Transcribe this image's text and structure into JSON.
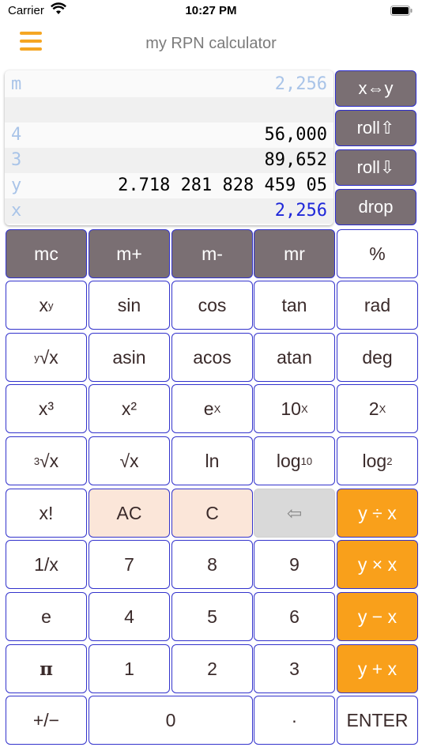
{
  "status": {
    "carrier": "Carrier",
    "time": "10:27 PM"
  },
  "nav": {
    "title": "my RPN calculator"
  },
  "registers": [
    {
      "label": "m",
      "value": "2,256",
      "color": "#a9c4e8"
    },
    {
      "label": "",
      "value": "",
      "color": "#000000"
    },
    {
      "label": "4",
      "value": "56,000",
      "color": "#000000"
    },
    {
      "label": "3",
      "value": "89,652",
      "color": "#000000"
    },
    {
      "label": "y",
      "value": "2.718 281 828 459 05",
      "color": "#000000"
    },
    {
      "label": "x",
      "value": "2,256",
      "color": "#1e27d9"
    }
  ],
  "stack_buttons": {
    "swap": "x⇔y",
    "roll_up": "roll⇧",
    "roll_down": "roll⇩",
    "drop": "drop"
  },
  "keys": {
    "mc": "mc",
    "mplus": "m+",
    "mminus": "m-",
    "mr": "mr",
    "percent": "%",
    "xy_base": "x",
    "xy_sup": "y",
    "sin": "sin",
    "cos": "cos",
    "tan": "tan",
    "rad": "rad",
    "yroot_sup": "y",
    "yroot_base": "√x",
    "asin": "asin",
    "acos": "acos",
    "atan": "atan",
    "deg": "deg",
    "cube": "x³",
    "square": "x²",
    "ex_base": "e",
    "ex_sup": "X",
    "tenx_base": "10",
    "tenx_sup": "X",
    "twox_base": "2",
    "twox_sup": "X",
    "croot_sup": "3",
    "croot_base": "√x",
    "sqrt": "√x",
    "ln": "ln",
    "log10_base": "log",
    "log10_sub": "10",
    "log2_base": "log",
    "log2_sub": "2",
    "fact": "x!",
    "ac": "AC",
    "c": "C",
    "back": "⇦",
    "div": "y ÷ x",
    "recip": "1/x",
    "seven": "7",
    "eight": "8",
    "nine": "9",
    "mul": "y × x",
    "e": "e",
    "four": "4",
    "five": "5",
    "six": "6",
    "sub": "y − x",
    "pi": "π",
    "one": "1",
    "two": "2",
    "three": "3",
    "add": "y + x",
    "sign": "+/−",
    "zero": "0",
    "dot": "·",
    "enter": "ENTER"
  }
}
